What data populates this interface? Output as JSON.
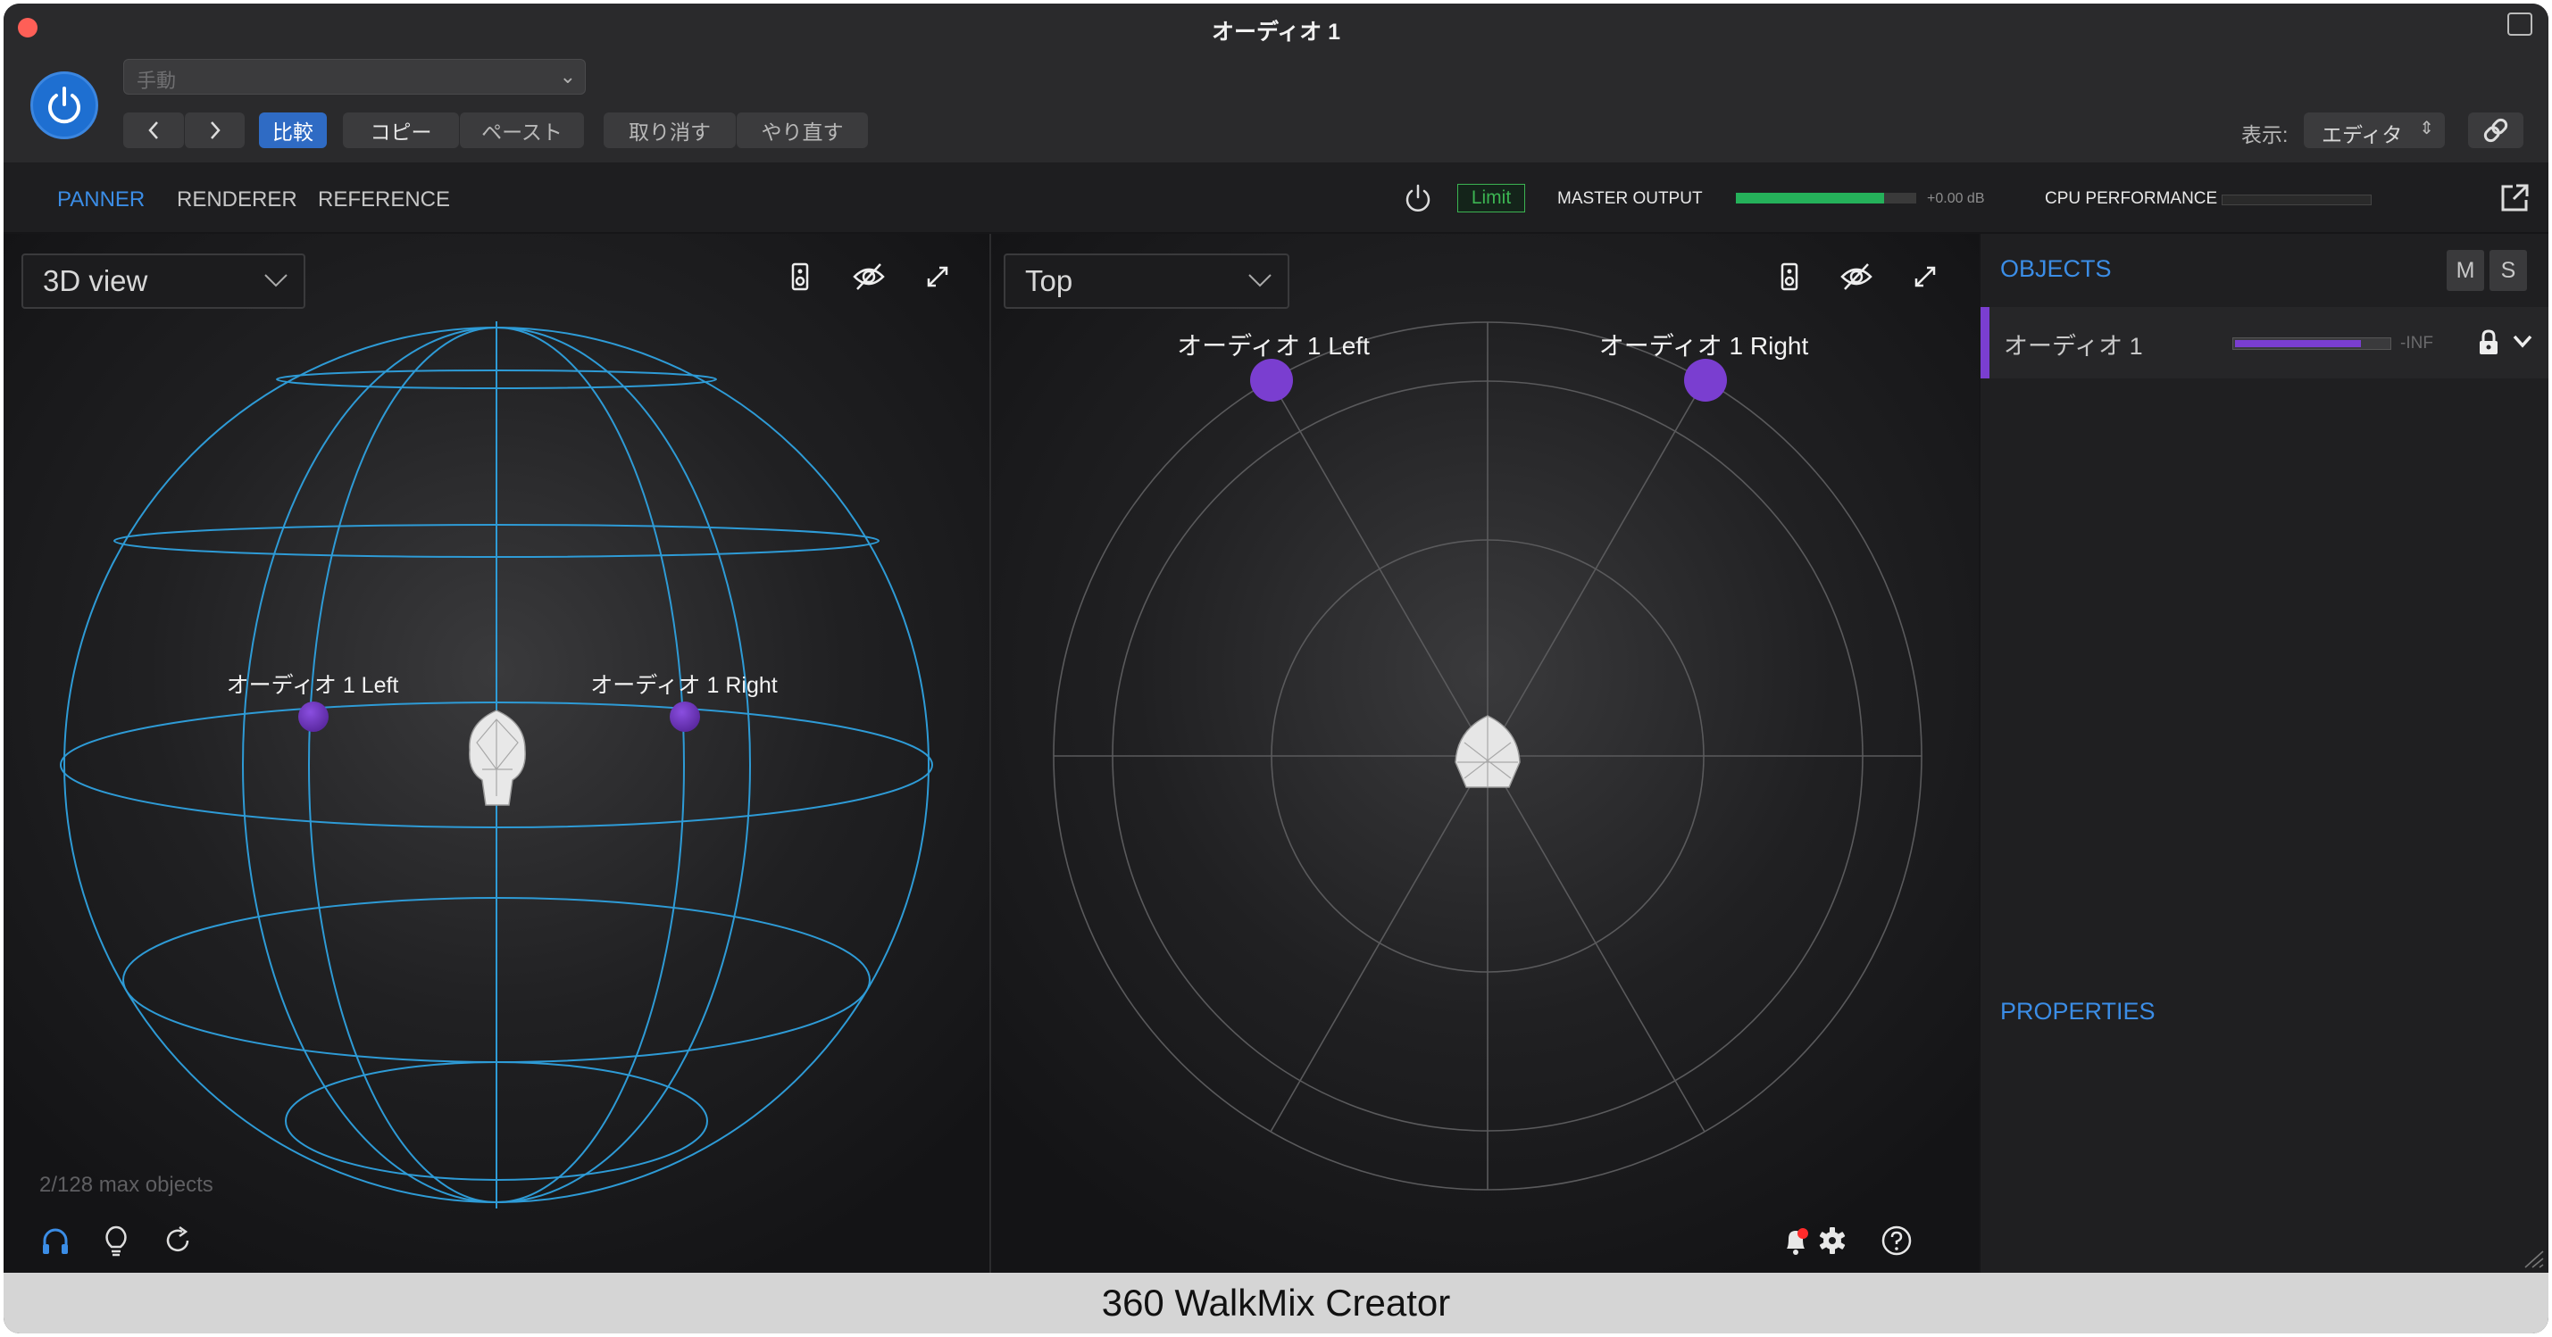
{
  "window": {
    "title": "オーディオ 1"
  },
  "host": {
    "preset_placeholder": "手動",
    "compare": "比較",
    "copy": "コピー",
    "paste": "ペースト",
    "undo": "取り消す",
    "redo": "やり直す",
    "show_label": "表示:",
    "view_value": "エディタ"
  },
  "tabs": [
    {
      "label": "PANNER",
      "active": true
    },
    {
      "label": "RENDERER",
      "active": false
    },
    {
      "label": "REFERENCE",
      "active": false
    }
  ],
  "topbar": {
    "limit": "Limit",
    "master_output_label": "MASTER OUTPUT",
    "master_output_db": "+0.00 dB",
    "master_output_level": 0.82,
    "cpu_label": "CPU PERFORMANCE",
    "cpu_level": 0.0
  },
  "left_view": {
    "dropdown": "3D view",
    "objects": [
      {
        "label": "オーディオ 1 Left"
      },
      {
        "label": "オーディオ 1 Right"
      }
    ],
    "max_objects": "2/128 max objects"
  },
  "mid_view": {
    "dropdown": "Top",
    "objects": [
      {
        "label": "オーディオ 1 Left"
      },
      {
        "label": "オーディオ 1 Right"
      }
    ]
  },
  "objects_panel": {
    "header": "OBJECTS",
    "mute": "M",
    "solo": "S",
    "items": [
      {
        "name": "オーディオ 1",
        "level": "-INF",
        "meter": 0.82
      }
    ],
    "properties_header": "PROPERTIES"
  },
  "footer": {
    "caption": "360 WalkMix Creator"
  },
  "colors": {
    "accent_blue": "#3b8de6",
    "object_purple": "#7a3ed0",
    "meter_green": "#25b15a",
    "sphere_line": "#2e9bd6"
  }
}
